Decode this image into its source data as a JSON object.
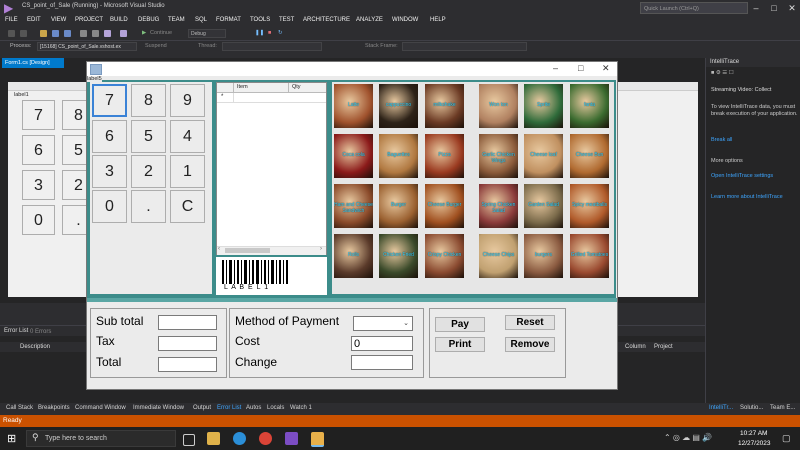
{
  "vs": {
    "title": "CS_point_of_Sale (Running) - Microsoft Visual Studio",
    "quick_launch_placeholder": "Quick Launch (Ctrl+Q)",
    "menu": [
      "FILE",
      "EDIT",
      "VIEW",
      "PROJECT",
      "BUILD",
      "DEBUG",
      "TEAM",
      "SQL",
      "FORMAT",
      "TOOLS",
      "TEST",
      "ARCHITECTURE",
      "ANALYZE",
      "WINDOW",
      "HELP"
    ],
    "toolbar": {
      "continue": "Continue",
      "config": "Debug",
      "process_label": "Process:",
      "process_value": "[15168] CS_point_of_Sale.vshost.ex",
      "suspend": "Suspend",
      "thread": "Thread:",
      "stack_frame": "Stack Frame:"
    },
    "doc_tab": "Form1.cs [Design]",
    "design_label": "label1",
    "design_keys": [
      "7",
      "8",
      "6",
      "5",
      "3",
      "2",
      "0",
      "."
    ],
    "intellitrace": {
      "title": "IntelliTrace",
      "streaming": "Streaming Video: Collect",
      "msg": "To view IntelliTrace data, you must break execution of your application.",
      "break_all": "Break all",
      "more_options": "More options",
      "open_settings": "Open IntelliTrace settings",
      "learn_more": "Learn more about IntelliTrace"
    },
    "error_list": {
      "title": "Error List",
      "errors": "0 Errors",
      "col_description": "Description",
      "col_column": "Column",
      "col_project": "Project"
    },
    "bottom_tabs": [
      "Call Stack",
      "Breakpoints",
      "Command Window",
      "Immediate Window",
      "Output",
      "Error List",
      "Autos",
      "Locals",
      "Watch 1"
    ],
    "right_tabs": [
      "IntelliTr...",
      "Solutio...",
      "Team E..."
    ],
    "status": "Ready"
  },
  "taskbar": {
    "search_placeholder": "Type here to search",
    "time": "10:27 AM",
    "date": "12/27/2023"
  },
  "pos": {
    "label5": "label5",
    "keypad": [
      "7",
      "8",
      "9",
      "6",
      "5",
      "4",
      "3",
      "2",
      "1",
      "0",
      ".",
      "C"
    ],
    "grid": {
      "col_item": "Item",
      "col_qty": "Qty",
      "row_marker": "*"
    },
    "barcode_text": "L A B E L 1",
    "products": [
      {
        "name": "Latte",
        "color": "#a0522d"
      },
      {
        "name": "cappuccino",
        "color": "#2d2218"
      },
      {
        "name": "milkshake",
        "color": "#6b3a24"
      },
      {
        "name": "Won ton",
        "color": "#b08060"
      },
      {
        "name": "Sprite",
        "color": "#2f6b3a"
      },
      {
        "name": "fanta",
        "color": "#3a6b2f"
      },
      {
        "name": "Coca cola",
        "color": "#8b1a1a"
      },
      {
        "name": "Baguettes",
        "color": "#b07840"
      },
      {
        "name": "Pizza",
        "color": "#9a3a20"
      },
      {
        "name": "Garlic Chicken Wings",
        "color": "#8a5a3a"
      },
      {
        "name": "Cheese loaf",
        "color": "#c09060"
      },
      {
        "name": "Cheese Bun",
        "color": "#b06a30"
      },
      {
        "name": "Ham and Cheese Sandwich",
        "color": "#8a4a2a"
      },
      {
        "name": "Burger",
        "color": "#9a6030"
      },
      {
        "name": "Cheese Burger",
        "color": "#a05020"
      },
      {
        "name": "Spring Chicken Salad",
        "color": "#8a3a3a"
      },
      {
        "name": "Garden Salad",
        "color": "#7a6a4a"
      },
      {
        "name": "Spicy meatballs",
        "color": "#b05a2a"
      },
      {
        "name": "Rolls",
        "color": "#5a3a2a"
      },
      {
        "name": "Chicken Fried",
        "color": "#3a4a2a"
      },
      {
        "name": "Crispy Chicken",
        "color": "#8a4a30"
      },
      {
        "name": "Cheese Chips",
        "color": "#c0a070"
      },
      {
        "name": "burgers",
        "color": "#8a5a40"
      },
      {
        "name": "Grilled Tomatoes",
        "color": "#9a4a30"
      }
    ],
    "totals": {
      "subtotal_label": "Sub total",
      "tax_label": "Tax",
      "total_label": "Total",
      "method_label": "Method of Payment",
      "cost_label": "Cost",
      "cost_value": "0",
      "change_label": "Change"
    },
    "buttons": {
      "pay": "Pay",
      "reset": "Reset",
      "print": "Print",
      "remove": "Remove"
    }
  }
}
